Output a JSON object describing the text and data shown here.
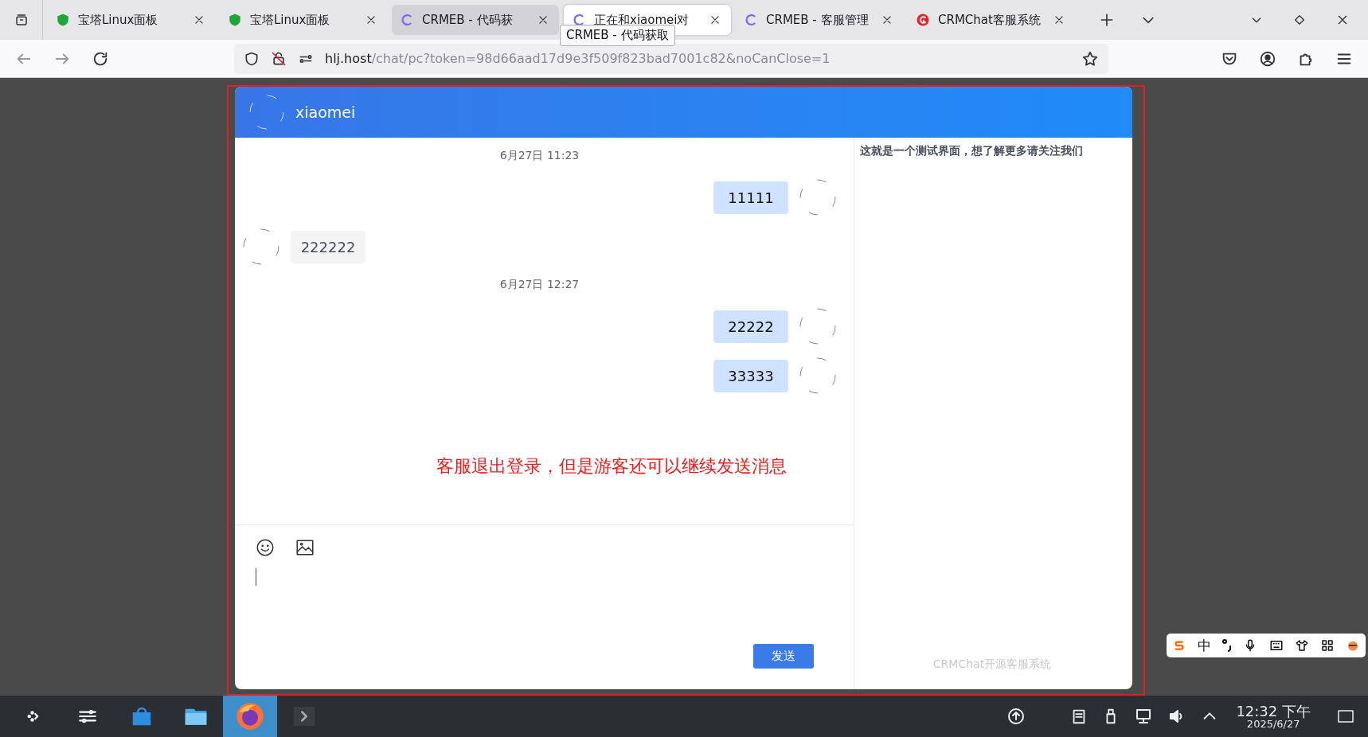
{
  "browser": {
    "tabs": [
      {
        "title": "宝塔Linux面板",
        "kind": "bt",
        "selected": false,
        "hovered": false
      },
      {
        "title": "宝塔Linux面板",
        "kind": "bt",
        "selected": false,
        "hovered": false
      },
      {
        "title": "CRMEB - 代码获",
        "kind": "crmeb",
        "selected": false,
        "hovered": true
      },
      {
        "title": "正在和xiaomei对",
        "kind": "crmeb",
        "selected": true,
        "hovered": false
      },
      {
        "title": "CRMEB - 客服管理",
        "kind": "crmeb",
        "selected": false,
        "hovered": false
      },
      {
        "title": "CRMChat客服系统",
        "kind": "crmchat",
        "selected": false,
        "hovered": false
      }
    ],
    "tooltip": "CRMEB - 代码获取",
    "url": {
      "host": "hlj.host",
      "path": "/chat/pc?token=98d66aad17d9e3f509f823bad7001c82&noCanClose=1"
    }
  },
  "chat": {
    "header": {
      "name": "xiaomei"
    },
    "messages": [
      {
        "kind": "time",
        "text": "6月27日 11:23"
      },
      {
        "kind": "sent",
        "text": "11111"
      },
      {
        "kind": "received",
        "text": "222222"
      },
      {
        "kind": "time",
        "text": "6月27日 12:27"
      },
      {
        "kind": "sent",
        "text": "22222"
      },
      {
        "kind": "sent",
        "text": "33333"
      }
    ],
    "annotation": "客服退出登录，但是游客还可以继续发送消息",
    "send_button": "发送",
    "side_notice": "这就是一个测试界面，想了解更多请关注我们",
    "footer": "CRMChat开源客服系统"
  },
  "taskbar": {
    "apps": [
      {
        "kind": "launcher",
        "selected": false
      },
      {
        "kind": "settings",
        "selected": false
      },
      {
        "kind": "store",
        "selected": false
      },
      {
        "kind": "files",
        "selected": false
      },
      {
        "kind": "firefox",
        "selected": true
      },
      {
        "kind": "terminal",
        "selected": false
      }
    ],
    "clock": {
      "time": "12:32 下午",
      "date": "2025/6/27"
    }
  },
  "ime": {
    "mode": "中"
  }
}
